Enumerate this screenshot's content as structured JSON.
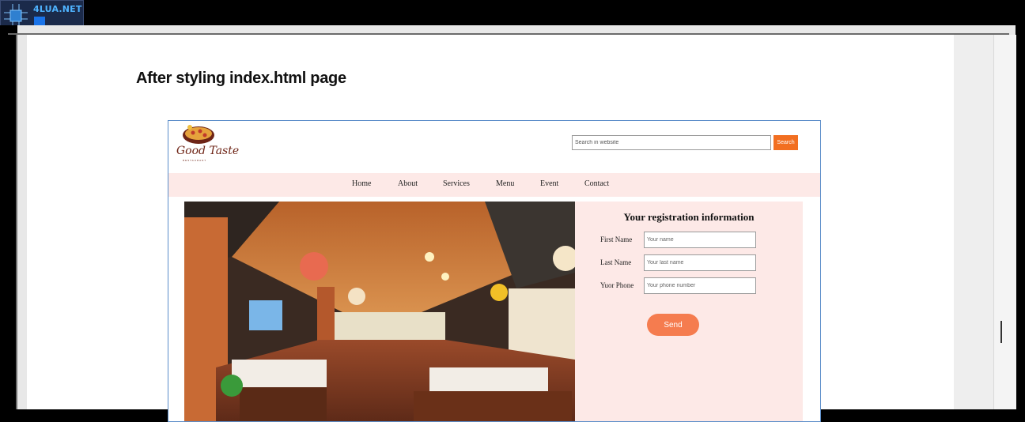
{
  "watermark": {
    "brand": "4LUA.NET"
  },
  "slide": {
    "heading": "After styling index.html page"
  },
  "site": {
    "logo": {
      "name": "Good Taste",
      "tagline": "RESTAURANT"
    },
    "search": {
      "placeholder": "Search in website",
      "button_label": "Search"
    },
    "nav": [
      "Home",
      "About",
      "Services",
      "Menu",
      "Event",
      "Contact"
    ],
    "form": {
      "title": "Your registration information",
      "fields": [
        {
          "label": "First Name",
          "placeholder": "Your name"
        },
        {
          "label": "Last Name",
          "placeholder": "Your last name"
        },
        {
          "label": "Yuor Phone",
          "placeholder": "Your phone number"
        }
      ],
      "send_label": "Send"
    }
  },
  "colors": {
    "accent": "#f26f21",
    "send_button": "#f57c4f",
    "nav_background": "#fde9e7",
    "frame_border": "#5b8dc9"
  }
}
